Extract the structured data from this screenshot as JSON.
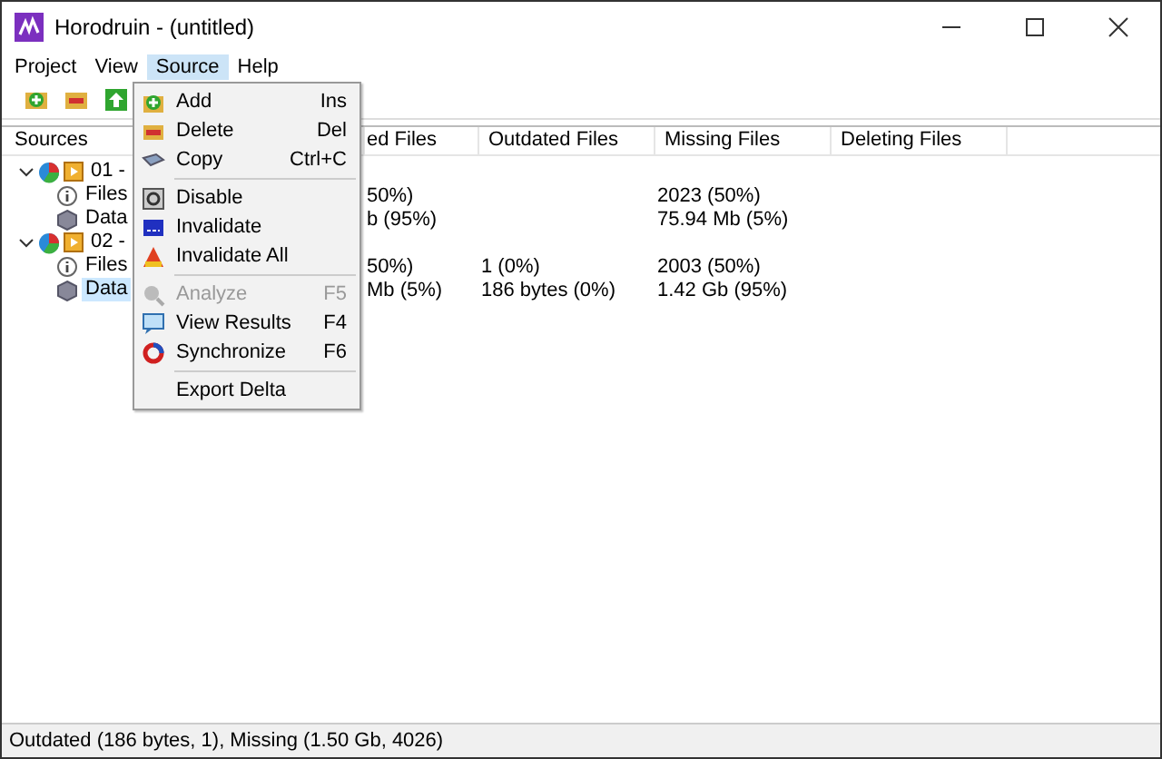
{
  "window": {
    "title": "Horodruin - (untitled)"
  },
  "menu_bar": [
    {
      "label": "Project",
      "selected": false
    },
    {
      "label": "View",
      "selected": false
    },
    {
      "label": "Source",
      "selected": true
    },
    {
      "label": "Help",
      "selected": false
    }
  ],
  "tree": {
    "header": "Sources",
    "nodes": [
      {
        "label": "01 -",
        "expanded": true,
        "children": [
          {
            "label": "Files",
            "selected": false
          },
          {
            "label": "Data",
            "selected": false
          }
        ]
      },
      {
        "label": "02 -",
        "expanded": true,
        "children": [
          {
            "label": "Files",
            "selected": false
          },
          {
            "label": "Data",
            "selected": true
          }
        ]
      }
    ]
  },
  "table": {
    "columns": [
      "ed Files",
      "Outdated Files",
      "Missing Files",
      "Deleting Files"
    ],
    "groups": [
      {
        "rows": [
          {
            "c1": "50%)",
            "c3": "2023 (50%)"
          },
          {
            "c1": "b (95%)",
            "c3": "75.94 Mb (5%)"
          }
        ]
      },
      {
        "rows": [
          {
            "c1": "50%)",
            "c2": "1 (0%)",
            "c3": "2003 (50%)"
          },
          {
            "c1": "Mb (5%)",
            "c2": "186 bytes (0%)",
            "c3": "1.42 Gb (95%)"
          }
        ]
      }
    ]
  },
  "context_menu": [
    {
      "kind": "item",
      "label": "Add",
      "shortcut": "Ins",
      "disabled": false
    },
    {
      "kind": "item",
      "label": "Delete",
      "shortcut": "Del",
      "disabled": false
    },
    {
      "kind": "item",
      "label": "Copy",
      "shortcut": "Ctrl+C",
      "disabled": false
    },
    {
      "kind": "separator"
    },
    {
      "kind": "item",
      "label": "Disable",
      "disabled": false
    },
    {
      "kind": "item",
      "label": "Invalidate",
      "disabled": false
    },
    {
      "kind": "item",
      "label": "Invalidate All",
      "disabled": false
    },
    {
      "kind": "separator"
    },
    {
      "kind": "item",
      "label": "Analyze",
      "shortcut": "F5",
      "disabled": true
    },
    {
      "kind": "item",
      "label": "View Results",
      "shortcut": "F4",
      "disabled": false
    },
    {
      "kind": "item",
      "label": "Synchronize",
      "shortcut": "F6",
      "disabled": false
    },
    {
      "kind": "separator"
    },
    {
      "kind": "item",
      "label": "Export Delta",
      "disabled": false
    }
  ],
  "status_bar": "Outdated (186 bytes, 1), Missing (1.50 Gb, 4026)"
}
